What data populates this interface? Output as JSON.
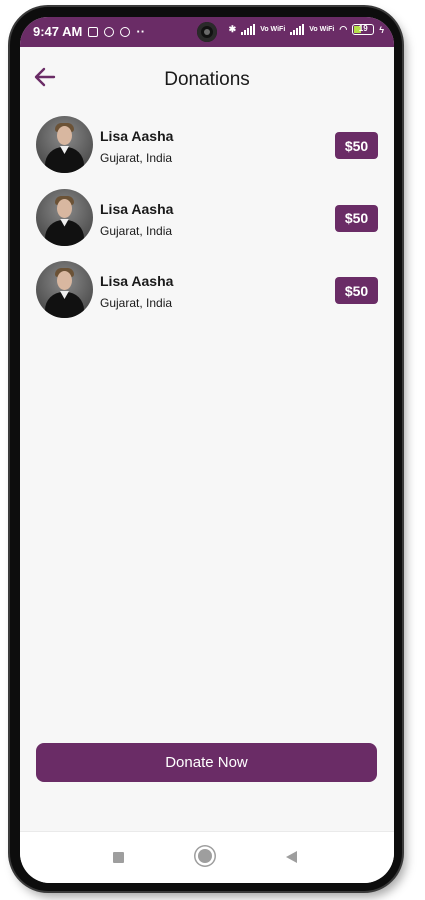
{
  "status_bar": {
    "time": "9:47 AM",
    "network_label": "Vo WiFi",
    "battery": "19"
  },
  "header": {
    "title": "Donations"
  },
  "donations": [
    {
      "name": "Lisa Aasha",
      "location": "Gujarat, India",
      "amount": "$50"
    },
    {
      "name": "Lisa Aasha",
      "location": "Gujarat, India",
      "amount": "$50"
    },
    {
      "name": "Lisa Aasha",
      "location": "Gujarat, India",
      "amount": "$50"
    }
  ],
  "actions": {
    "donate_label": "Donate Now"
  },
  "theme": {
    "accent": "#6a2c66"
  },
  "icons": {
    "back": "arrow-left-icon",
    "nav_recent": "square-icon",
    "nav_home": "circle-icon",
    "nav_back": "triangle-back-icon"
  }
}
